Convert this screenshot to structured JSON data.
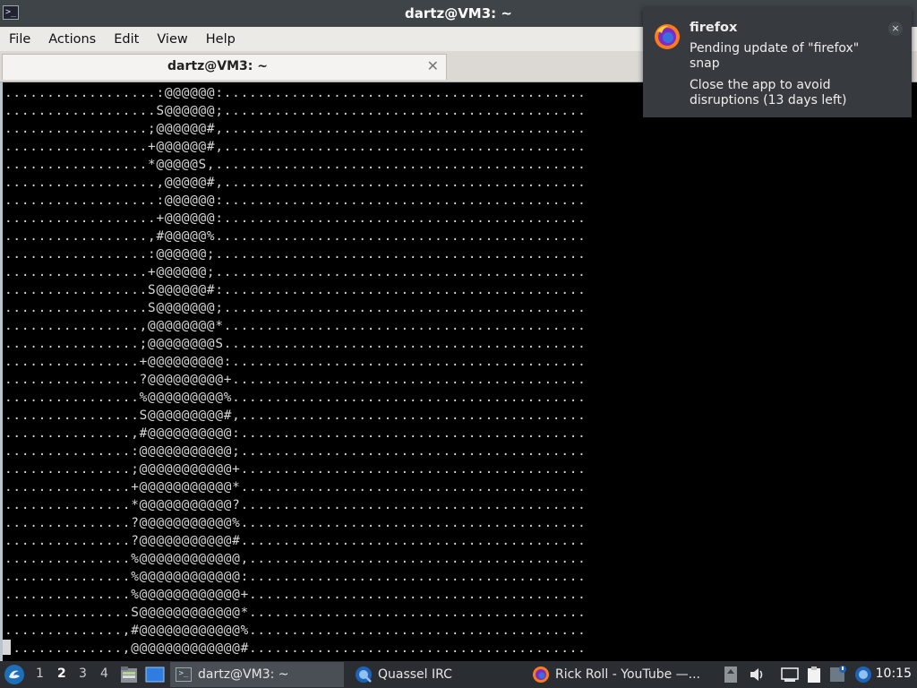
{
  "window": {
    "title": "dartz@VM3: ~"
  },
  "menu": [
    "File",
    "Actions",
    "Edit",
    "View",
    "Help"
  ],
  "tab": {
    "label": "dartz@VM3: ~"
  },
  "terminal": {
    "lines": [
      "..................:@@@@@@:...........................................",
      "..................S@@@@@@;...........................................",
      ".................;@@@@@@#,...........................................",
      ".................+@@@@@@#,...........................................",
      ".................*@@@@@S,............................................",
      "..................,@@@@@#,...........................................",
      "..................:@@@@@@:...........................................",
      "..................+@@@@@@:...........................................",
      ".................,#@@@@@%............................................",
      ".................:@@@@@@;............................................",
      ".................+@@@@@@;............................................",
      ".................S@@@@@@#:...........................................",
      ".................S@@@@@@@;...........................................",
      "................,@@@@@@@@*...........................................",
      "................;@@@@@@@@S...........................................",
      "................+@@@@@@@@@:..........................................",
      "................?@@@@@@@@@+..........................................",
      "................%@@@@@@@@@%..........................................",
      "................S@@@@@@@@@#,.........................................",
      "...............,#@@@@@@@@@@:.........................................",
      "...............:@@@@@@@@@@@;.........................................",
      "...............;@@@@@@@@@@@+.........................................",
      "...............+@@@@@@@@@@@*.........................................",
      "...............*@@@@@@@@@@@?.........................................",
      "...............?@@@@@@@@@@@%.........................................",
      "...............?@@@@@@@@@@@#.........................................",
      "...............%@@@@@@@@@@@@,........................................",
      "...............%@@@@@@@@@@@@:........................................",
      "...............%@@@@@@@@@@@@+........................................",
      "...............S@@@@@@@@@@@@*........................................",
      "..............,#@@@@@@@@@@@@%........................................",
      "..............,@@@@@@@@@@@@@#........................................"
    ]
  },
  "notification": {
    "app": "firefox",
    "summary": "Pending update of \"firefox\" snap",
    "body": "Close the app to avoid disruptions (13 days left)",
    "close_label": "×"
  },
  "taskbar": {
    "workspaces": [
      "1",
      "2",
      "3",
      "4"
    ],
    "active_workspace": "2",
    "tasks": [
      {
        "label": "dartz@VM3: ~",
        "icon": "terminal-icon"
      },
      {
        "label": "Quassel IRC",
        "icon": "quassel-icon"
      },
      {
        "label": "Rick Roll - YouTube —...",
        "icon": "firefox-icon"
      }
    ],
    "clock": "10:15"
  },
  "colors": {
    "terminal_bg": "#000000",
    "terminal_fg": "#d8d8d8",
    "titlebar_bg": "#3f4449",
    "taskbar_bg": "#2a2e33",
    "notification_bg": "#373b3f"
  }
}
